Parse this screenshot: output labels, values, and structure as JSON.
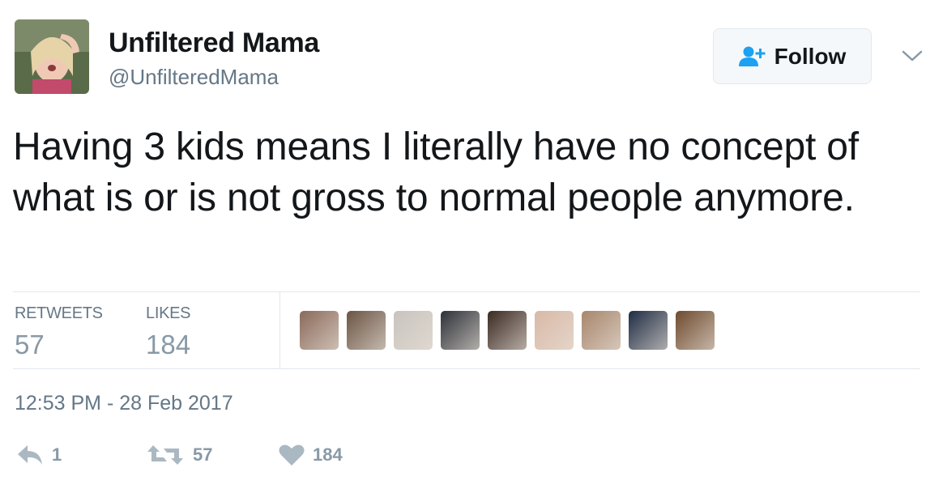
{
  "user": {
    "display_name": "Unfiltered Mama",
    "handle": "@UnfilteredMama"
  },
  "follow_button": {
    "label": "Follow",
    "icon": "add-user-icon",
    "accent": "#1da1f2"
  },
  "tweet": {
    "text": "Having 3 kids means I literally have no concept of what is or is not gross to normal people anymore."
  },
  "stats": {
    "retweets_label": "RETWEETS",
    "retweets_count": "57",
    "likes_label": "LIKES",
    "likes_count": "184"
  },
  "likers": [
    {
      "name": "liker-avatar-1",
      "color": "#8a6a5a"
    },
    {
      "name": "liker-avatar-2",
      "color": "#6b5544"
    },
    {
      "name": "liker-avatar-3",
      "color": "#c8c4bd"
    },
    {
      "name": "liker-avatar-4",
      "color": "#2d3138"
    },
    {
      "name": "liker-avatar-5",
      "color": "#3a2a22"
    },
    {
      "name": "liker-avatar-6",
      "color": "#d9b9a6"
    },
    {
      "name": "liker-avatar-7",
      "color": "#a8866c"
    },
    {
      "name": "liker-avatar-8",
      "color": "#1f2d44"
    },
    {
      "name": "liker-avatar-9",
      "color": "#6f4b2e"
    }
  ],
  "timestamp": "12:53 PM - 28 Feb 2017",
  "actions": {
    "reply_count": "1",
    "retweet_count": "57",
    "like_count": "184"
  },
  "colors": {
    "text": "#14171a",
    "secondary": "#657786",
    "muted": "#8899a6",
    "border": "#e1e8ed"
  }
}
